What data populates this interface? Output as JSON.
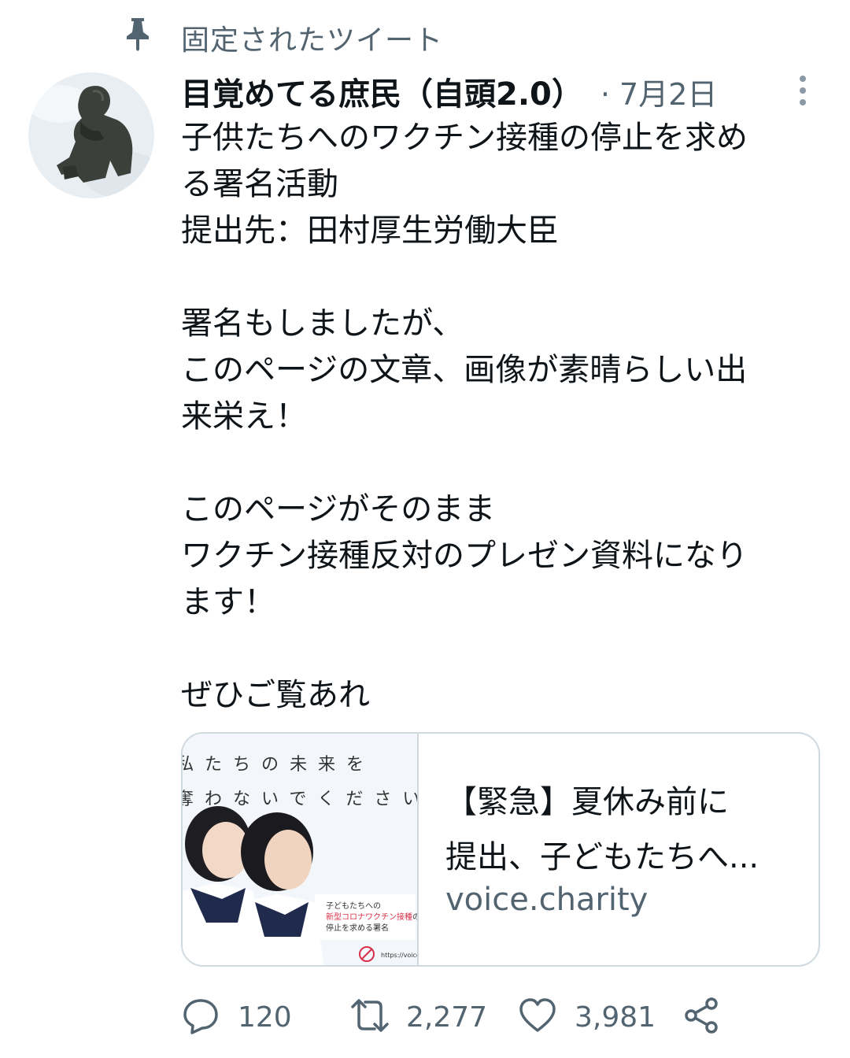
{
  "pinned": {
    "label": "固定されたツイート",
    "icon": "pin-icon"
  },
  "tweet": {
    "author_name": "目覚めてる庶民（自頭2.0）",
    "date": "· 7月2日",
    "text_lines": [
      "子供たちへのワクチン接種の停止を求め",
      "る署名活動",
      "提出先：田村厚生労働大臣",
      "",
      "署名もしましたが、",
      "このページの文章、画像が素晴らしい出",
      "来栄え！",
      "",
      "このページがそのまま",
      "ワクチン接種反対のプレゼン資料になり",
      "ます！",
      "",
      "ぜひご覧あれ"
    ]
  },
  "card": {
    "image": {
      "line1": "私たちの未来を",
      "line2": "奪わないでください",
      "caption_line1": "子どもたちへの",
      "caption_line2_highlight": "新型コロナワクチン接種",
      "caption_line2_tail": "の",
      "caption_line3": "停止を求める署名",
      "url": "https://voice.ch"
    },
    "title_line1": "【緊急】夏休み前に",
    "title_line2": "提出、子どもたちへ...",
    "domain": "voice.charity"
  },
  "actions": {
    "reply_count": "120",
    "retweet_count": "2,277",
    "like_count": "3,981"
  },
  "colors": {
    "text": "#0f1419",
    "secondary": "#536471",
    "border": "#cfd9de",
    "highlight": "#d9304a"
  }
}
